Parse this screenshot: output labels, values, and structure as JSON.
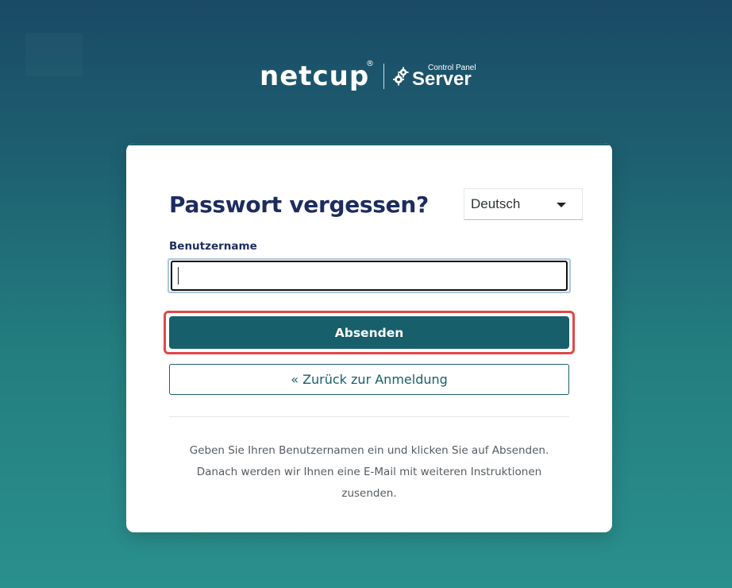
{
  "logo": {
    "brand": "netcup",
    "registered_mark": "®",
    "product_caption": "Control Panel",
    "product_name": "Server"
  },
  "card": {
    "title": "Passwort vergessen?",
    "language_select": {
      "selected": "Deutsch"
    },
    "username_field": {
      "label": "Benutzername",
      "value": ""
    },
    "submit_label": "Absenden",
    "back_label": "« Zurück zur Anmeldung",
    "help_lines": [
      "Geben Sie Ihren Benutzernamen ein und klicken Sie auf Absenden.",
      "Danach werden wir Ihnen eine E-Mail mit weiteren Instruktionen",
      "zusenden."
    ]
  },
  "colors": {
    "accent": "#175f6b",
    "title": "#1d2c5e",
    "highlight": "#e04848"
  },
  "icons": {
    "logo_gear": "gear-icon",
    "language_dropdown": "caret-down-icon"
  }
}
